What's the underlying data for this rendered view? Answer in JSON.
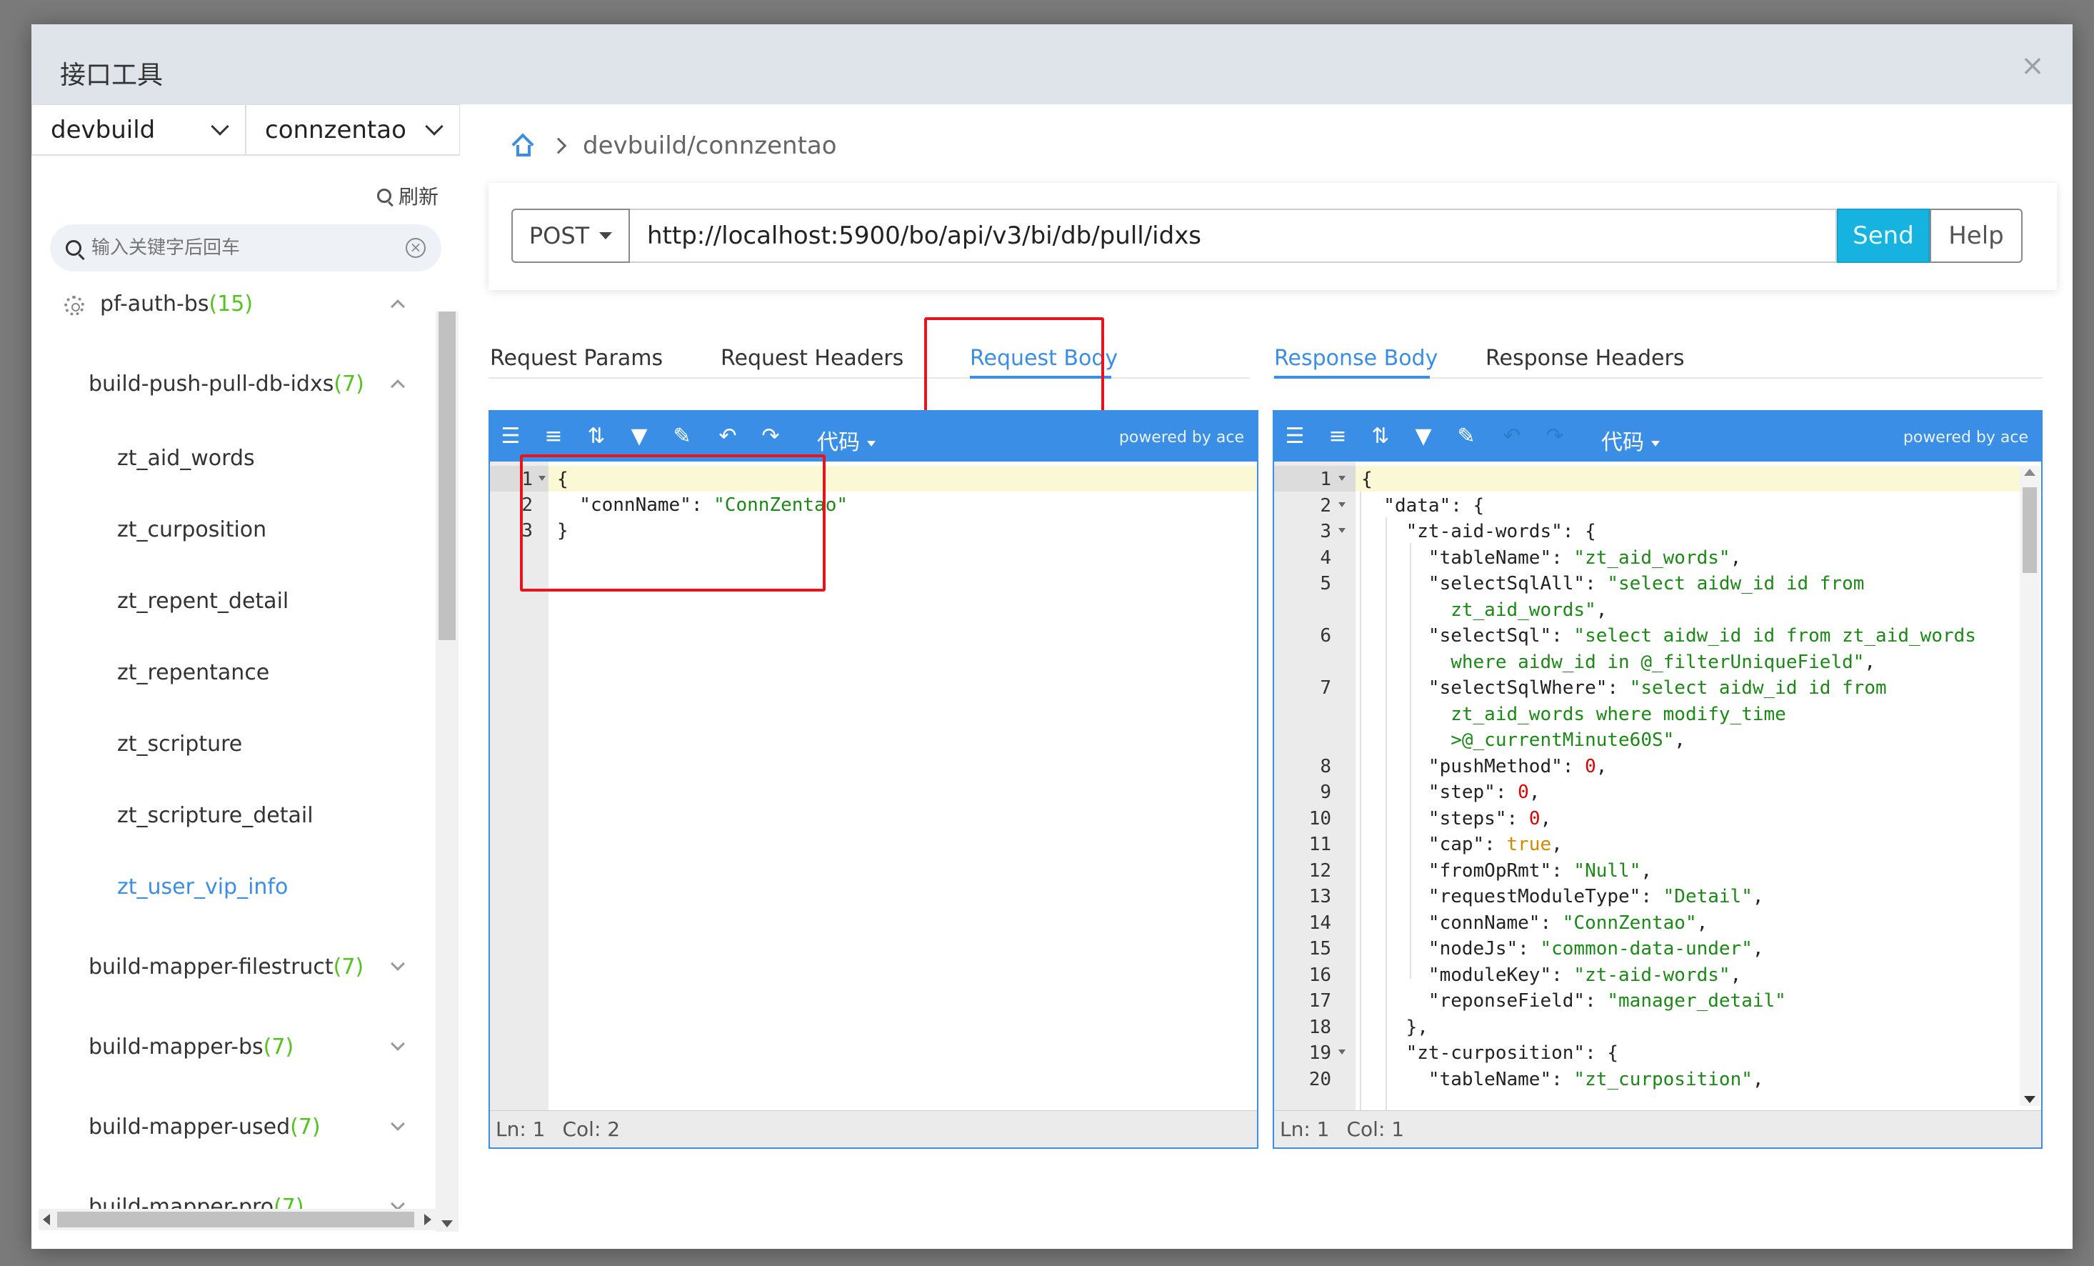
{
  "dialog": {
    "title": "接口工具",
    "close_label": "×"
  },
  "left": {
    "project_select": "devbuild",
    "db_select": "connzentao",
    "refresh_label": "刷新",
    "search_placeholder": "输入关键字后回车",
    "tree": [
      {
        "label": "pf-auth-bs",
        "count": "(15)",
        "level": 0,
        "expanded": true,
        "icon": "gear-icon"
      },
      {
        "label": "build-push-pull-db-idxs",
        "count": "(7)",
        "level": 1,
        "expanded": true
      },
      {
        "label": "zt_aid_words",
        "level": 2
      },
      {
        "label": "zt_curposition",
        "level": 2
      },
      {
        "label": "zt_repent_detail",
        "level": 2
      },
      {
        "label": "zt_repentance",
        "level": 2
      },
      {
        "label": "zt_scripture",
        "level": 2
      },
      {
        "label": "zt_scripture_detail",
        "level": 2
      },
      {
        "label": "zt_user_vip_info",
        "level": 2,
        "active": true
      },
      {
        "label": "build-mapper-filestruct",
        "count": "(7)",
        "level": 1,
        "expanded": false
      },
      {
        "label": "build-mapper-bs",
        "count": "(7)",
        "level": 1,
        "expanded": false
      },
      {
        "label": "build-mapper-used",
        "count": "(7)",
        "level": 1,
        "expanded": false
      },
      {
        "label": "build-mapper-pro",
        "count": "(7)",
        "level": 1,
        "expanded": false
      }
    ]
  },
  "breadcrumb": {
    "path": "devbuild/connzentao"
  },
  "request": {
    "method": "POST",
    "url": "http://localhost:5900/bo/api/v3/bi/db/pull/idxs",
    "send_label": "Send",
    "help_label": "Help"
  },
  "left_tabs": [
    {
      "label": "Request Params",
      "active": false
    },
    {
      "label": "Request Headers",
      "active": false
    },
    {
      "label": "Request Body",
      "active": true
    }
  ],
  "right_tabs": [
    {
      "label": "Response Body",
      "active": true
    },
    {
      "label": "Response Headers",
      "active": false
    }
  ],
  "editor": {
    "code_menu_label": "代码",
    "powered_by": "powered by ace",
    "status_ln": "Ln: 1",
    "status_col": "Col: 2",
    "status_col_right": "Col: 1"
  },
  "request_body_lines": [
    "{",
    "  \"connName\": \"ConnZentao\"",
    "}"
  ],
  "response_lines": [
    {
      "n": "1",
      "fold": true,
      "parts": [
        [
          "p",
          "{"
        ]
      ]
    },
    {
      "n": "2",
      "fold": true,
      "parts": [
        [
          "k",
          "  \"data\": {"
        ]
      ]
    },
    {
      "n": "3",
      "fold": true,
      "parts": [
        [
          "k",
          "    \"zt-aid-words\": {"
        ]
      ]
    },
    {
      "n": "4",
      "parts": [
        [
          "k",
          "      \"tableName\": "
        ],
        [
          "s",
          "\"zt_aid_words\""
        ],
        [
          "k",
          ","
        ]
      ]
    },
    {
      "n": "5",
      "parts": [
        [
          "k",
          "      \"selectSqlAll\": "
        ],
        [
          "s",
          "\"select aidw_id id from"
        ]
      ]
    },
    {
      "n": "",
      "parts": [
        [
          "s",
          "        zt_aid_words\""
        ],
        [
          "k",
          ","
        ]
      ]
    },
    {
      "n": "6",
      "parts": [
        [
          "k",
          "      \"selectSql\": "
        ],
        [
          "s",
          "\"select aidw_id id from zt_aid_words"
        ]
      ]
    },
    {
      "n": "",
      "parts": [
        [
          "s",
          "        where aidw_id in @_filterUniqueField\""
        ],
        [
          "k",
          ","
        ]
      ]
    },
    {
      "n": "7",
      "parts": [
        [
          "k",
          "      \"selectSqlWhere\": "
        ],
        [
          "s",
          "\"select aidw_id id from"
        ]
      ]
    },
    {
      "n": "",
      "parts": [
        [
          "s",
          "        zt_aid_words where modify_time"
        ]
      ]
    },
    {
      "n": "",
      "parts": [
        [
          "s",
          "        >@_currentMinute60S\""
        ],
        [
          "k",
          ","
        ]
      ]
    },
    {
      "n": "8",
      "parts": [
        [
          "k",
          "      \"pushMethod\": "
        ],
        [
          "n",
          "0"
        ],
        [
          "k",
          ","
        ]
      ]
    },
    {
      "n": "9",
      "parts": [
        [
          "k",
          "      \"step\": "
        ],
        [
          "n",
          "0"
        ],
        [
          "k",
          ","
        ]
      ]
    },
    {
      "n": "10",
      "parts": [
        [
          "k",
          "      \"steps\": "
        ],
        [
          "n",
          "0"
        ],
        [
          "k",
          ","
        ]
      ]
    },
    {
      "n": "11",
      "parts": [
        [
          "k",
          "      \"cap\": "
        ],
        [
          "b",
          "true"
        ],
        [
          "k",
          ","
        ]
      ]
    },
    {
      "n": "12",
      "parts": [
        [
          "k",
          "      \"fromOpRmt\": "
        ],
        [
          "s",
          "\"Null\""
        ],
        [
          "k",
          ","
        ]
      ]
    },
    {
      "n": "13",
      "parts": [
        [
          "k",
          "      \"requestModuleType\": "
        ],
        [
          "s",
          "\"Detail\""
        ],
        [
          "k",
          ","
        ]
      ]
    },
    {
      "n": "14",
      "parts": [
        [
          "k",
          "      \"connName\": "
        ],
        [
          "s",
          "\"ConnZentao\""
        ],
        [
          "k",
          ","
        ]
      ]
    },
    {
      "n": "15",
      "parts": [
        [
          "k",
          "      \"nodeJs\": "
        ],
        [
          "s",
          "\"common-data-under\""
        ],
        [
          "k",
          ","
        ]
      ]
    },
    {
      "n": "16",
      "parts": [
        [
          "k",
          "      \"moduleKey\": "
        ],
        [
          "s",
          "\"zt-aid-words\""
        ],
        [
          "k",
          ","
        ]
      ]
    },
    {
      "n": "17",
      "parts": [
        [
          "k",
          "      \"reponseField\": "
        ],
        [
          "s",
          "\"manager_detail\""
        ]
      ]
    },
    {
      "n": "18",
      "parts": [
        [
          "k",
          "    },"
        ]
      ]
    },
    {
      "n": "19",
      "fold": true,
      "parts": [
        [
          "k",
          "    \"zt-curposition\": {"
        ]
      ]
    },
    {
      "n": "20",
      "parts": [
        [
          "k",
          "      \"tableName\": "
        ],
        [
          "s",
          "\"zt_curposition\""
        ],
        [
          "k",
          ","
        ]
      ]
    }
  ],
  "colors": {
    "accent": "#3a8ee6",
    "send": "#17b3e0",
    "count": "#52c41a",
    "string": "#1a8a14",
    "number": "#e00000",
    "boolean": "#d38a00",
    "highlight_box": "#e8141b"
  }
}
